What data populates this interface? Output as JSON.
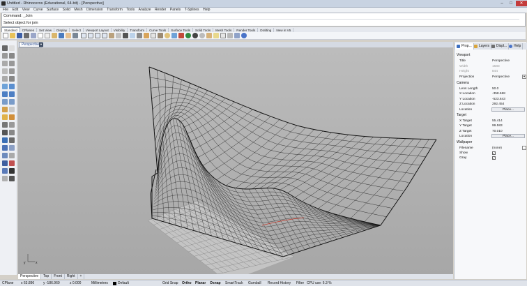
{
  "window": {
    "title": "Untitled - Rhinoceros (Educational, 64-bit) - [Perspective]",
    "minimize": "–",
    "maximize": "□",
    "close": "✕"
  },
  "menu": [
    "File",
    "Edit",
    "View",
    "Curve",
    "Surface",
    "Solid",
    "Mesh",
    "Dimension",
    "Transform",
    "Tools",
    "Analyze",
    "Render",
    "Panels",
    "T-Splines",
    "Help"
  ],
  "command": {
    "history": "Command: _Join",
    "prompt": "Select object for join"
  },
  "toolbar_tabs": [
    "Standard",
    "CPlanes",
    "Set View",
    "Display",
    "Select",
    "Viewport Layout",
    "Visibility",
    "Transform",
    "Curve Tools",
    "Surface Tools",
    "Solid Tools",
    "Mesh Tools",
    "Render Tools",
    "Drafting",
    "New in V5"
  ],
  "active_toolbar_tab": "Standard",
  "viewport": {
    "name": "Perspective",
    "menu_arrow": "▼",
    "axis_x": "x",
    "axis_y": "y"
  },
  "view_tabs": [
    "Perspective",
    "Top",
    "Front",
    "Right",
    "+"
  ],
  "panel": {
    "tabs": [
      "Prop...",
      "Layers",
      "Displ...",
      "Help"
    ],
    "viewport_section": "Viewport",
    "title_label": "Title",
    "title_value": "Perspective",
    "width_label": "Width",
    "width_value": "1583",
    "height_label": "Height",
    "height_value": "844",
    "projection_label": "Projection",
    "projection_value": "Perspective",
    "camera_section": "Camera",
    "lens_label": "Lens Length",
    "lens_value": "50.0",
    "xloc_label": "X Location",
    "xloc_value": "-358.668",
    "yloc_label": "Y Location",
    "yloc_value": "-523.643",
    "zloc_label": "Z Location",
    "zloc_value": "292.454",
    "location_label": "Location",
    "place_label": "Place...",
    "target_section": "Target",
    "xt_label": "X Target",
    "xt_value": "55.414",
    "yt_label": "Y Target",
    "yt_value": "99.583",
    "zt_label": "Z Target",
    "zt_value": "70.010",
    "tloc_label": "Location",
    "tplace_label": "Place...",
    "wallpaper_section": "Wallpaper",
    "filename_label": "Filename",
    "filename_value": "(none)",
    "filename_btn": "...",
    "show_label": "Show",
    "show_check": "✓",
    "gray_label": "Gray",
    "gray_check": "✓"
  },
  "status": {
    "cplane": "CPlane",
    "x": "x 63.896",
    "y": "y -186.960",
    "z": "z 0.000",
    "units": "Millimeters",
    "layer": "Default",
    "grid_snap": "Grid Snap",
    "ortho": "Ortho",
    "planar": "Planar",
    "osnap": "Osnap",
    "smarttrack": "SmartTrack",
    "gumball": "Gumball",
    "record_history": "Record History",
    "filter": "Filter",
    "cpu": "CPU use: 6.3 %"
  },
  "colors": {
    "viewport_bg": "#b4b4b4",
    "wire": "#111111",
    "grid": "#8e8e8e",
    "accent_blue": "#1b3f86"
  }
}
